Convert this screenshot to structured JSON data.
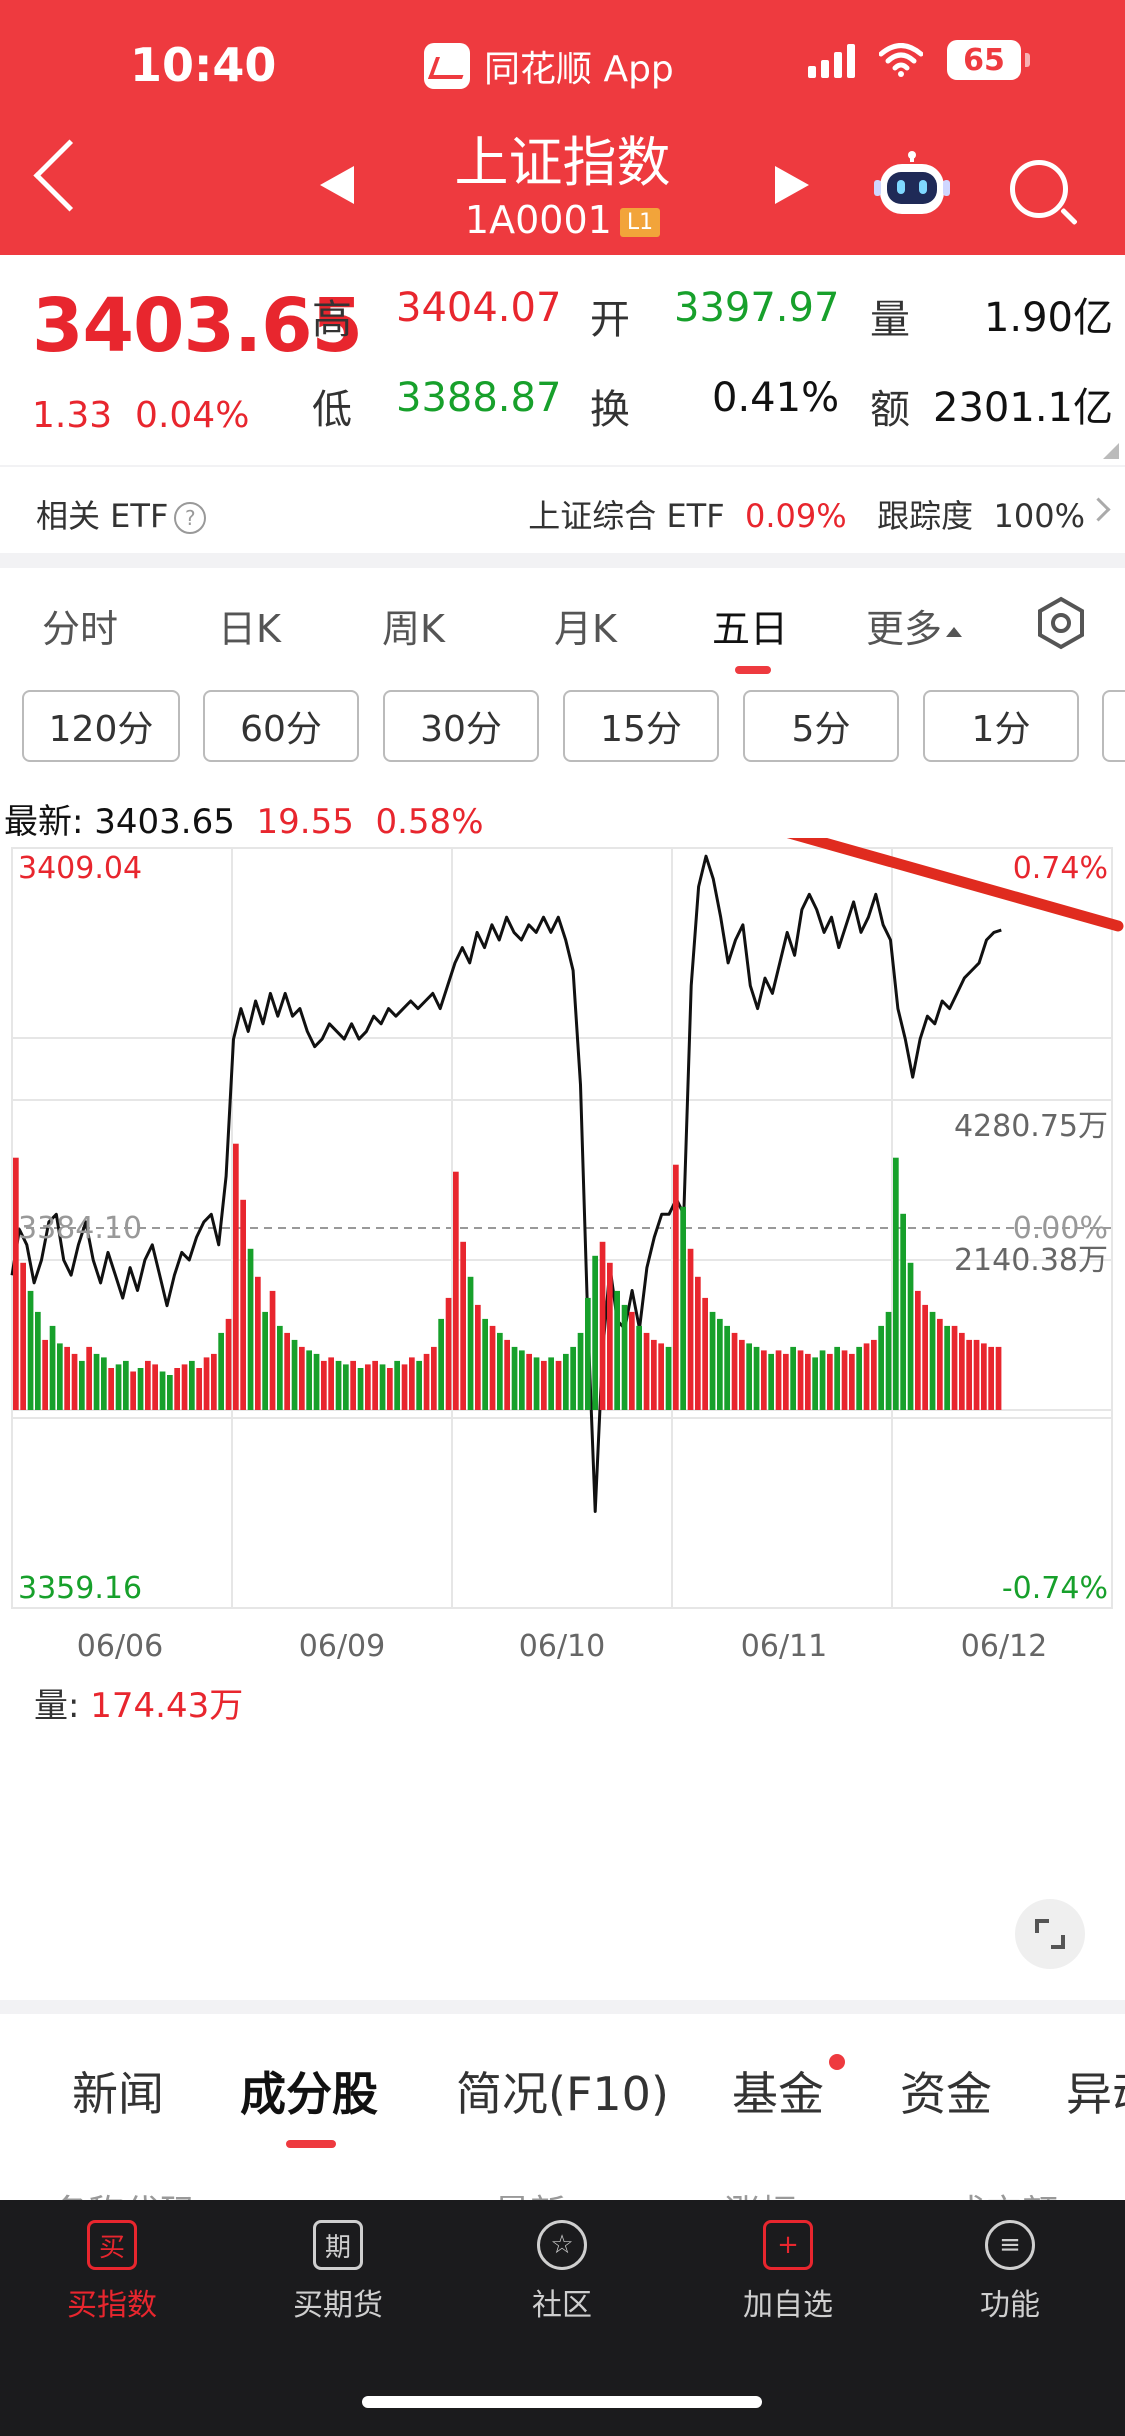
{
  "status": {
    "time": "10:40",
    "app": "同花顺 App",
    "battery": "65"
  },
  "header": {
    "title": "上证指数",
    "code": "1A0001",
    "level": "L1"
  },
  "quote": {
    "price": "3403.65",
    "change": "1.33",
    "change_pct": "0.04%",
    "high_label": "高",
    "high": "3404.07",
    "open_label": "开",
    "open": "3397.97",
    "volume_label": "量",
    "volume": "1.90亿",
    "low_label": "低",
    "low": "3388.87",
    "turnover_label": "换",
    "turnover": "0.41%",
    "amount_label": "额",
    "amount": "2301.1亿"
  },
  "etf": {
    "label": "相关 ETF",
    "help": "?",
    "name": "上证综合 ETF",
    "pct": "0.09%",
    "tracking_label": "跟踪度",
    "tracking": "100%"
  },
  "chart_tabs": [
    "分时",
    "日K",
    "周K",
    "月K",
    "五日",
    "更多"
  ],
  "active_chart_tab": "五日",
  "intervals": [
    "120分",
    "60分",
    "30分",
    "15分",
    "5分",
    "1分"
  ],
  "latest": {
    "label": "最新:",
    "value": "3403.65",
    "change": "19.55",
    "pct": "0.58%"
  },
  "volume": {
    "label": "量:",
    "value": "174.43万"
  },
  "colors": {
    "up": "#e8262e",
    "down": "#17a02b",
    "header": "#ee3a3f",
    "trend": "#e02b1f"
  },
  "chart_data": [
    {
      "type": "line",
      "ylim": [
        3359.16,
        3409.04
      ],
      "y_ticks_left": [
        "3409.04",
        "3384.10",
        "3359.16"
      ],
      "y_ticks_right": [
        "0.74%",
        "0.00%",
        "-0.74%"
      ],
      "x_labels": [
        "06/06",
        "06/09",
        "06/10",
        "06/11",
        "06/12"
      ],
      "reference": 3384.1,
      "series": [
        {
          "values": [
            3381.0,
            3384.0,
            3383.0,
            3380.5,
            3382.0,
            3384.5,
            3385.0,
            3382.0,
            3381.0,
            3383.0,
            3384.5,
            3382.0,
            3380.5,
            3382.5,
            3381.0,
            3379.5,
            3381.5,
            3380.0,
            3382.0,
            3383.0,
            3381.0,
            3379.0,
            3381.0,
            3382.5,
            3382.0,
            3383.5,
            3384.5,
            3385.0,
            3383.0,
            3387.5,
            3396.5,
            3398.5,
            3397.0,
            3399.0,
            3397.5,
            3399.5,
            3398.0,
            3399.5,
            3398.0,
            3398.5,
            3397.0,
            3396.0,
            3396.5,
            3397.5,
            3397.0,
            3396.5,
            3397.5,
            3396.5,
            3397.0,
            3398.0,
            3397.5,
            3398.5,
            3398.0,
            3398.5,
            3399.0,
            3398.5,
            3399.0,
            3399.5,
            3398.5,
            3400.0,
            3401.5,
            3402.5,
            3401.5,
            3403.5,
            3402.5,
            3404.0,
            3403.0,
            3404.5,
            3403.5,
            3403.0,
            3404.0,
            3403.5,
            3404.5,
            3403.5,
            3404.5,
            3403.0,
            3401.0,
            3393.5,
            3378.0,
            3365.5,
            3376.0,
            3381.5,
            3378.0,
            3377.5,
            3380.0,
            3377.5,
            3381.5,
            3383.5,
            3385.0,
            3385.0,
            3386.0,
            3385.0,
            3400.0,
            3406.5,
            3408.5,
            3407.0,
            3404.5,
            3401.5,
            3403.0,
            3404.0,
            3400.0,
            3398.5,
            3400.5,
            3399.5,
            3401.5,
            3403.5,
            3402.0,
            3405.0,
            3406.0,
            3405.0,
            3403.5,
            3404.5,
            3402.5,
            3404.0,
            3405.5,
            3403.5,
            3404.5,
            3406.0,
            3404.0,
            3403.0,
            3398.5,
            3396.5,
            3394.0,
            3396.5,
            3398.0,
            3397.5,
            3399.0,
            3398.5,
            3399.5,
            3400.5,
            3401.0,
            3401.5,
            3403.0,
            3403.5,
            3403.65
          ]
        }
      ]
    },
    {
      "type": "bar",
      "ylim": [
        0,
        4280.75
      ],
      "y_ticks": [
        "4280.75万",
        "2140.38万"
      ],
      "values": [
        3600,
        2100,
        1700,
        1400,
        1000,
        1200,
        950,
        900,
        800,
        700,
        900,
        800,
        750,
        600,
        650,
        700,
        550,
        600,
        700,
        650,
        550,
        500,
        600,
        650,
        700,
        600,
        750,
        800,
        1100,
        1300,
        3800,
        3000,
        2300,
        1900,
        1400,
        1700,
        1200,
        1100,
        1000,
        900,
        850,
        800,
        700,
        750,
        700,
        650,
        700,
        600,
        650,
        700,
        650,
        600,
        700,
        650,
        750,
        700,
        800,
        900,
        1300,
        1600,
        3400,
        2400,
        1900,
        1500,
        1300,
        1200,
        1100,
        1000,
        900,
        850,
        800,
        750,
        700,
        750,
        700,
        800,
        900,
        1100,
        1600,
        2200,
        2400,
        2100,
        1700,
        1500,
        1400,
        1200,
        1100,
        1000,
        950,
        900,
        3500,
        2900,
        2300,
        1900,
        1600,
        1400,
        1300,
        1200,
        1100,
        1000,
        950,
        900,
        850,
        800,
        850,
        800,
        900,
        850,
        800,
        750,
        850,
        800,
        900,
        850,
        800,
        900,
        950,
        1000,
        1200,
        1400,
        3600,
        2800,
        2100,
        1700,
        1500,
        1400,
        1300,
        1200,
        1200,
        1100,
        1000,
        1000,
        950,
        900,
        900
      ],
      "up": [
        1,
        1,
        0,
        0,
        1,
        0,
        0,
        1,
        1,
        0,
        1,
        0,
        0,
        1,
        0,
        0,
        1,
        0,
        1,
        1,
        0,
        0,
        1,
        1,
        0,
        1,
        1,
        1,
        0,
        1,
        1,
        1,
        0,
        1,
        0,
        1,
        0,
        1,
        0,
        1,
        0,
        0,
        1,
        1,
        0,
        0,
        1,
        0,
        1,
        1,
        0,
        1,
        0,
        1,
        1,
        0,
        1,
        1,
        0,
        1,
        1,
        1,
        0,
        1,
        0,
        1,
        0,
        1,
        0,
        0,
        1,
        0,
        1,
        0,
        1,
        0,
        0,
        0,
        0,
        0,
        1,
        1,
        0,
        0,
        1,
        0,
        1,
        1,
        1,
        0,
        1,
        0,
        1,
        1,
        1,
        0,
        0,
        0,
        1,
        1,
        0,
        0,
        1,
        0,
        1,
        1,
        0,
        1,
        1,
        0,
        0,
        1,
        0,
        1,
        1,
        0,
        1,
        1,
        0,
        0,
        0,
        0,
        0,
        1,
        1,
        0,
        1,
        0,
        1,
        1,
        1,
        1,
        1,
        1,
        1
      ]
    }
  ],
  "lower_tabs": [
    "新闻",
    "成分股",
    "简况(F10)",
    "基金",
    "资金",
    "异动"
  ],
  "active_lower_tab": "成分股",
  "list_columns": [
    "名称代码",
    "最新",
    "涨幅",
    "成交额"
  ],
  "bottom_nav": [
    {
      "label": "买指数",
      "icon": "买"
    },
    {
      "label": "买期货",
      "icon": "期"
    },
    {
      "label": "社区",
      "icon": "☆"
    },
    {
      "label": "加自选",
      "icon": "+"
    },
    {
      "label": "功能",
      "icon": "≡"
    }
  ]
}
